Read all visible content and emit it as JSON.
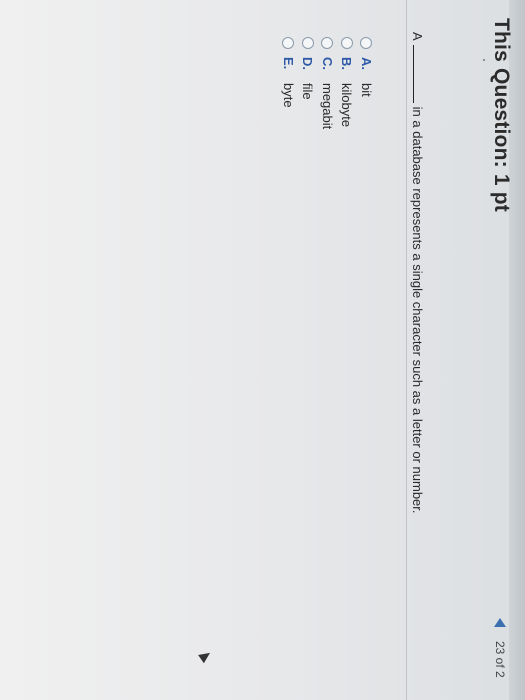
{
  "header": {
    "title": "This Question: 1 pt",
    "counter": "23 of 2"
  },
  "question": {
    "prefix": "A",
    "text": "in a database represents a single character such as a letter or number."
  },
  "choices": [
    {
      "letter": "A.",
      "text": "bit"
    },
    {
      "letter": "B.",
      "text": "kilobyte"
    },
    {
      "letter": "C.",
      "text": "megabit"
    },
    {
      "letter": "D.",
      "text": "file"
    },
    {
      "letter": "E.",
      "text": "byte"
    }
  ],
  "colors": {
    "accent": "#2f5aa8",
    "nav_arrow": "#3b6fb0",
    "background": "#e4e6e8"
  }
}
